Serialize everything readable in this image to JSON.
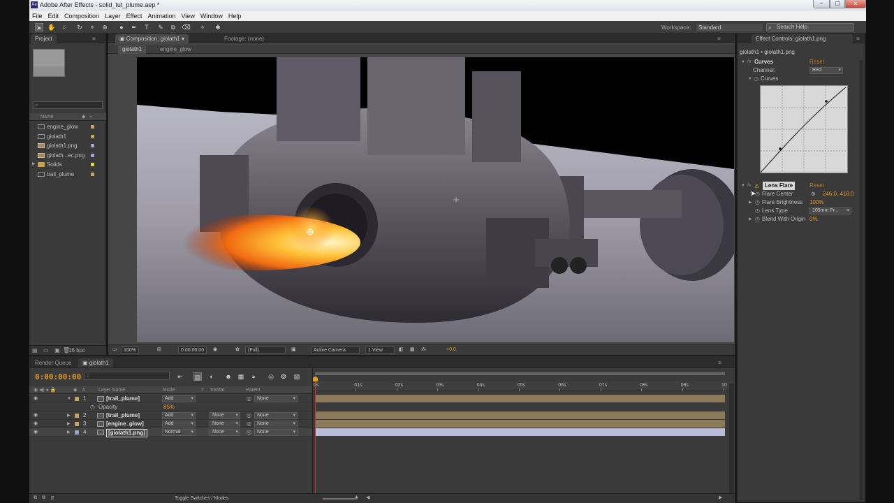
{
  "window": {
    "app_icon_label": "Ae",
    "title": "Adobe After Effects - solid_tut_plume.aep *",
    "min": "–",
    "max": "☐",
    "close": "✕"
  },
  "menu": [
    "File",
    "Edit",
    "Composition",
    "Layer",
    "Effect",
    "Animation",
    "View",
    "Window",
    "Help"
  ],
  "toolbar": {
    "workspace_label": "Workspace:",
    "workspace_value": "Standard",
    "search_placeholder": "Search Help"
  },
  "project": {
    "tab": "Project",
    "search_icon": "⌕",
    "column_name": "Name",
    "items": [
      {
        "name": "engine_glow",
        "type": "comp",
        "color": "#c8a060"
      },
      {
        "name": "giolath1",
        "type": "comp",
        "color": "#c8a060"
      },
      {
        "name": "giolath1.png",
        "type": "image",
        "color": "#a0a0c8"
      },
      {
        "name": "giolath...ec.png",
        "type": "image",
        "color": "#a0a0c8"
      },
      {
        "name": "Solids",
        "type": "folder",
        "color": "#e6d23a"
      },
      {
        "name": "trail_plume",
        "type": "comp",
        "color": "#c8a060"
      }
    ],
    "bpc": "16 bpc"
  },
  "composition": {
    "tab": "Composition: giolath1",
    "footage_tab": "Footage: (none)",
    "subtabs": [
      "giolath1",
      "engine_glow"
    ],
    "footer": {
      "zoom": "100%",
      "timecode": "0:00:00:00",
      "resolution": "(Full)",
      "camera": "Active Camera",
      "views": "1 View",
      "exposure": "+0.0"
    }
  },
  "effect_controls": {
    "tab": "Effect Controls: giolath1.png",
    "subtitle": "giolath1 • giolath1.png",
    "curves": {
      "name": "Curves",
      "reset": "Reset",
      "channel_label": "Channel:",
      "channel_value": "Red",
      "curves_label": "Curves"
    },
    "lens_flare": {
      "name": "Lens Flare",
      "reset": "Reset",
      "flare_center_label": "Flare Center",
      "flare_center_value": "246.0, 418.0",
      "flare_brightness_label": "Flare Brightness",
      "flare_brightness_value": "100%",
      "lens_type_label": "Lens Type",
      "lens_type_value": "105mm Pr...",
      "blend_label": "Blend With Origin",
      "blend_value": "0%"
    },
    "fx_label": "fx"
  },
  "timeline": {
    "render_queue_tab": "Render Queue",
    "comp_tab": "giolath1",
    "timecode": "0:00:00:00",
    "search_icon": "⌕",
    "columns": {
      "layer_name": "Layer Name",
      "mode": "Mode",
      "t": "T",
      "trkmat": "TrkMat",
      "parent": "Parent",
      "hash": "#"
    },
    "layers": [
      {
        "num": "1",
        "name": "[trail_plume]",
        "mode": "Add",
        "trkmat": "",
        "parent": "None",
        "color": "#c8a060",
        "expanded": true
      },
      {
        "num": "2",
        "name": "[trail_plume]",
        "mode": "Add",
        "trkmat": "None",
        "parent": "None",
        "color": "#c8a060",
        "expanded": false
      },
      {
        "num": "3",
        "name": "[engine_glow]",
        "mode": "Add",
        "trkmat": "None",
        "parent": "None",
        "color": "#c8a060",
        "expanded": false
      },
      {
        "num": "4",
        "name": "[giolath1.png]",
        "mode": "Normal",
        "trkmat": "None",
        "parent": "None",
        "color": "#a0a0c8",
        "expanded": false
      }
    ],
    "opacity_label": "Opacity",
    "opacity_value": "85%",
    "ruler": [
      "0s",
      "01s",
      "02s",
      "03s",
      "04s",
      "05s",
      "06s",
      "07s",
      "08s",
      "09s",
      "10"
    ],
    "toggle_label": "Toggle Switches / Modes"
  },
  "colors": {
    "accent": "#e39a2c",
    "panel": "#3a3a3a",
    "layer_track_comp": "#8a7a5a",
    "layer_track_image": "#b8bcd8"
  }
}
